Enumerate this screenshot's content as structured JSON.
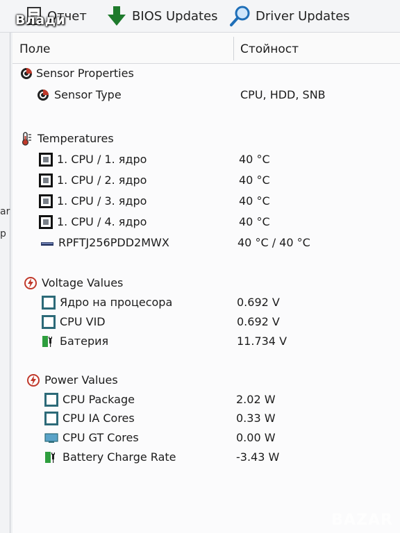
{
  "overlay": {
    "username": "Влади"
  },
  "toolbar": {
    "report_label": "Отчет",
    "bios_label": "BIOS Updates",
    "driver_label": "Driver Updates"
  },
  "left_fragments": [
    "ar",
    "p"
  ],
  "columns": {
    "field": "Поле",
    "value": "Стойност"
  },
  "sections": {
    "sensor": {
      "title": "Sensor Properties",
      "rows": [
        {
          "label": "Sensor Type",
          "value": "CPU, HDD, SNB"
        }
      ]
    },
    "temperatures": {
      "title": "Temperatures",
      "rows": [
        {
          "label": "1. CPU / 1. ядро",
          "value": "40 °C"
        },
        {
          "label": "1. CPU / 2. ядро",
          "value": "40 °C"
        },
        {
          "label": "1. CPU / 3. ядро",
          "value": "40 °C"
        },
        {
          "label": "1. CPU / 4. ядро",
          "value": "40 °C"
        },
        {
          "label": "RPFTJ256PDD2MWX",
          "value": "40 °C / 40 °C"
        }
      ]
    },
    "voltage": {
      "title": "Voltage Values",
      "rows": [
        {
          "label": "Ядро на процесора",
          "value": "0.692 V"
        },
        {
          "label": "CPU VID",
          "value": "0.692 V"
        },
        {
          "label": "Батерия",
          "value": "11.734 V"
        }
      ]
    },
    "power": {
      "title": "Power Values",
      "rows": [
        {
          "label": "CPU Package",
          "value": "2.02 W"
        },
        {
          "label": "CPU IA Cores",
          "value": "0.33 W"
        },
        {
          "label": "CPU GT Cores",
          "value": "0.00 W"
        },
        {
          "label": "Battery Charge Rate",
          "value": "-3.43 W"
        }
      ]
    }
  },
  "watermark": "BAZAR",
  "colors": {
    "accent_red": "#c0392b",
    "battery_green": "#2e9e3e",
    "search_blue": "#1f6fb8"
  }
}
